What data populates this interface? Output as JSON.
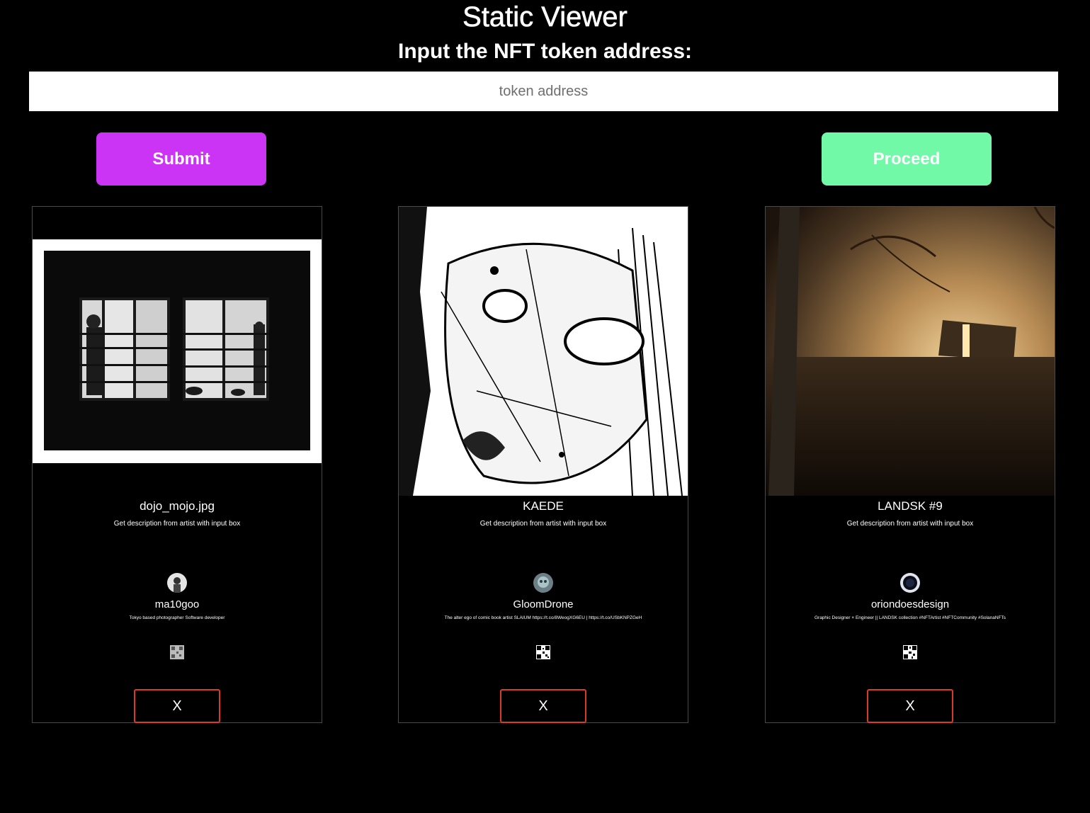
{
  "header": {
    "title": "Static Viewer",
    "prompt": "Input the NFT token address:"
  },
  "search": {
    "placeholder": "token address",
    "value": ""
  },
  "actions": {
    "submit_label": "Submit",
    "proceed_label": "Proceed"
  },
  "colors": {
    "submit": "#cc34f5",
    "proceed": "#71f9a8",
    "close_border": "#d93a2b",
    "background": "#000000"
  },
  "cards": [
    {
      "name": "dojo_mojo.jpg",
      "description": "Get description from artist with input box",
      "artist": "ma10goo",
      "bio": "Tokyo based photographer Software developer",
      "close_label": "X"
    },
    {
      "name": "KAEDE",
      "description": "Get description from artist with input box",
      "artist": "GloomDrone",
      "bio": "The alter ego of comic book artist SLAIUM https://t.co/8WeogXG6EU | https://t.co/USbKNPZGeH",
      "close_label": "X"
    },
    {
      "name": "LANDSK #9",
      "description": "Get description from artist with input box",
      "artist": "oriondoesdesign",
      "bio": "Graphic Designer × Engineer || LANDSK collection #NFTArtist #NFTCommunity #SolanaNFTs",
      "close_label": "X"
    }
  ]
}
